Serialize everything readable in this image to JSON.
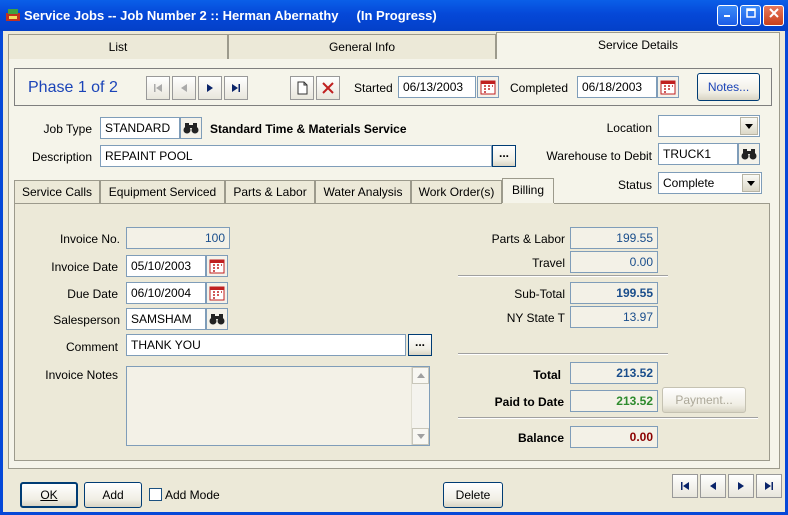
{
  "window": {
    "title": "Service Jobs -- Job Number 2 :: Herman Abernathy     (In Progress)"
  },
  "tabs": [
    {
      "label": "List"
    },
    {
      "label": "General Info"
    },
    {
      "label": "Service Details"
    }
  ],
  "phase": {
    "text": "Phase 1 of 2",
    "started_label": "Started",
    "started": "06/13/2003",
    "completed_label": "Completed",
    "completed": "06/18/2003",
    "notes_label": "Notes..."
  },
  "job": {
    "job_type_label": "Job Type",
    "job_type": "STANDARD",
    "job_type_desc": "Standard Time & Materials Service",
    "description_label": "Description",
    "description": "REPAINT POOL",
    "location_label": "Location",
    "location": "",
    "warehouse_label": "Warehouse to Debit",
    "warehouse": "TRUCK1",
    "status_label": "Status",
    "status": "Complete"
  },
  "subtabs": [
    {
      "label": "Service Calls"
    },
    {
      "label": "Equipment Serviced"
    },
    {
      "label": "Parts & Labor"
    },
    {
      "label": "Water Analysis"
    },
    {
      "label": "Work Order(s)"
    },
    {
      "label": "Billing"
    }
  ],
  "billing": {
    "invoice_no_label": "Invoice No.",
    "invoice_no": "100",
    "invoice_date_label": "Invoice Date",
    "invoice_date": "05/10/2003",
    "due_date_label": "Due Date",
    "due_date": "06/10/2004",
    "salesperson_label": "Salesperson",
    "salesperson": "SAMSHAM",
    "comment_label": "Comment",
    "comment": "THANK YOU",
    "invoice_notes_label": "Invoice Notes",
    "invoice_notes": "",
    "parts_labor_label": "Parts & Labor",
    "parts_labor": "199.55",
    "travel_label": "Travel",
    "travel": "0.00",
    "subtotal_label": "Sub-Total",
    "subtotal": "199.55",
    "tax_label": "NY State T",
    "tax": "13.97",
    "total_label": "Total",
    "total": "213.52",
    "paid_label": "Paid to Date",
    "paid": "213.52",
    "payment_label": "Payment...",
    "balance_label": "Balance",
    "balance": "0.00"
  },
  "footer": {
    "ok_label": "OK",
    "add_label": "Add",
    "add_mode_label": "Add Mode",
    "delete_label": "Delete"
  },
  "colors": {
    "title_blue": "#0548D8",
    "value_blue": "#1A4E8C",
    "paid_green": "#2E8B2E",
    "balance_red": "#8B0000",
    "phase_blue": "#1B44B8"
  }
}
